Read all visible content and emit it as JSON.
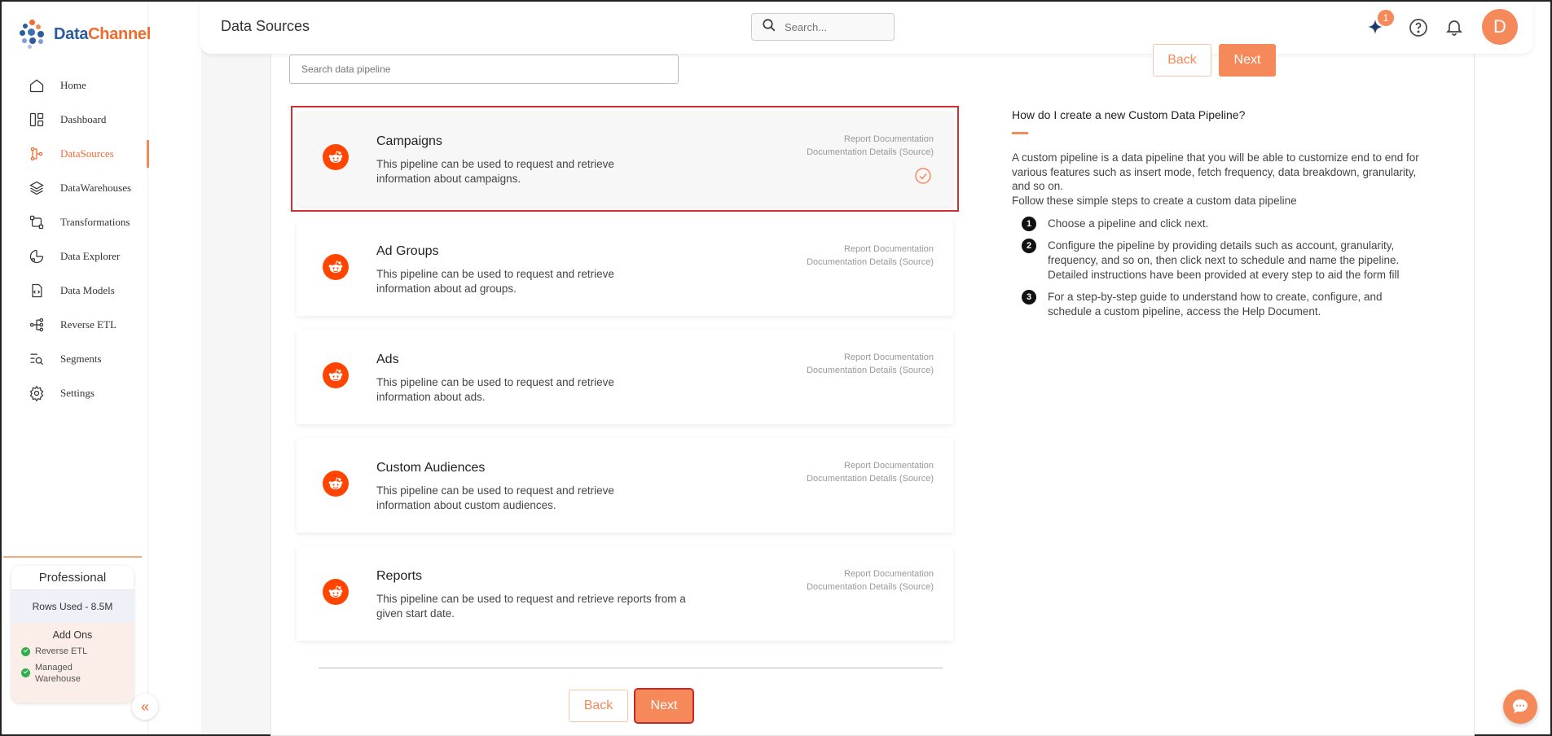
{
  "brand": {
    "name_part1": "Data",
    "name_part2": "Channel"
  },
  "header": {
    "title": "Data Sources",
    "search_placeholder": "Search...",
    "notification_count": "1",
    "avatar_letter": "D"
  },
  "sidebar": {
    "items": [
      {
        "label": "Home",
        "icon": "home-icon"
      },
      {
        "label": "Dashboard",
        "icon": "dashboard-icon"
      },
      {
        "label": "DataSources",
        "icon": "datasources-icon",
        "active": true
      },
      {
        "label": "DataWarehouses",
        "icon": "datawarehouses-icon"
      },
      {
        "label": "Transformations",
        "icon": "transformations-icon"
      },
      {
        "label": "Data Explorer",
        "icon": "data-explorer-icon"
      },
      {
        "label": "Data Models",
        "icon": "data-models-icon"
      },
      {
        "label": "Reverse ETL",
        "icon": "reverse-etl-icon"
      },
      {
        "label": "Segments",
        "icon": "segments-icon"
      },
      {
        "label": "Settings",
        "icon": "settings-icon"
      }
    ],
    "plan": {
      "name": "Professional",
      "rows_used": "Rows Used - 8.5M",
      "addons_title": "Add Ons",
      "addons": [
        "Reverse ETL",
        "Managed Warehouse"
      ]
    }
  },
  "pipeline": {
    "search_placeholder": "Search data pipeline",
    "back_label": "Back",
    "next_label": "Next",
    "cards": [
      {
        "title": "Campaigns",
        "description": "This pipeline can be used to request and retrieve information about campaigns.",
        "link1": "Report Documentation",
        "link2": "Documentation Details (Source)",
        "selected": true
      },
      {
        "title": "Ad Groups",
        "description": "This pipeline can be used to request and retrieve information about ad groups.",
        "link1": "Report Documentation",
        "link2": "Documentation Details (Source)",
        "selected": false
      },
      {
        "title": "Ads",
        "description": "This pipeline can be used to request and retrieve information about ads.",
        "link1": "Report Documentation",
        "link2": "Documentation Details (Source)",
        "selected": false
      },
      {
        "title": "Custom Audiences",
        "description": "This pipeline can be used to request and retrieve information about custom audiences.",
        "link1": "Report Documentation",
        "link2": "Documentation Details (Source)",
        "selected": false
      },
      {
        "title": "Reports",
        "description": "This pipeline can be used to request and retrieve reports from a given start date.",
        "link1": "Report Documentation",
        "link2": "Documentation Details (Source)",
        "selected": false
      }
    ]
  },
  "help": {
    "title": "How do I create a new Custom Data Pipeline?",
    "intro": "A custom pipeline is a data pipeline that you will be able to customize end to end for various features such as insert mode, fetch frequency, data breakdown, granularity, and so on.",
    "intro2": "Follow these simple steps to create a custom data pipeline",
    "steps": [
      {
        "num": "1",
        "text": "Choose a pipeline and click next."
      },
      {
        "num": "2",
        "text": "Configure the pipeline by providing details such as account, granularity, frequency, and so on, then click next to schedule and name the pipeline. Detailed instructions have been provided at every step to aid the form fill"
      },
      {
        "num": "3",
        "text": "For a step-by-step guide to understand how to create, configure, and schedule a custom pipeline, access the Help Document."
      }
    ]
  },
  "colors": {
    "accent": "#f5895a",
    "brand_blue": "#2b5c9e",
    "reddit": "#ff4500",
    "selected_border": "#d32f2f"
  }
}
